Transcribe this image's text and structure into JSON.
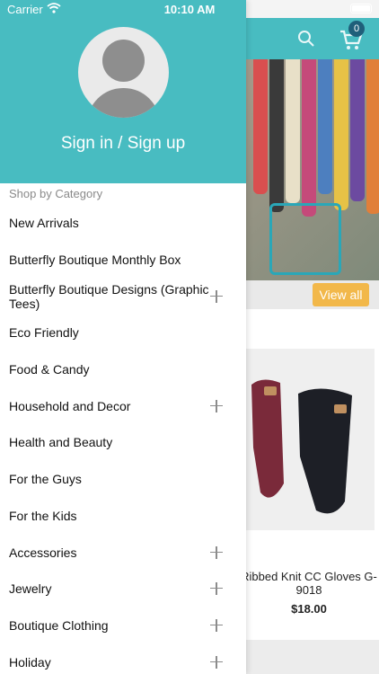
{
  "status_bar": {
    "carrier": "Carrier",
    "time": "10:10 AM"
  },
  "background": {
    "cart_badge": "0",
    "view_all_label": "View all",
    "product": {
      "name": "Ribbed Knit CC Gloves G-9018",
      "price": "$18.00"
    }
  },
  "drawer": {
    "signin_label": "Sign in / Sign up",
    "category_heading": "Shop by Category",
    "items": [
      {
        "label": "New Arrivals",
        "expandable": false
      },
      {
        "label": "Butterfly Boutique Monthly Box",
        "expandable": false
      },
      {
        "label": "Butterfly Boutique Designs (Graphic Tees)",
        "expandable": true
      },
      {
        "label": "Eco Friendly",
        "expandable": false
      },
      {
        "label": "Food & Candy",
        "expandable": false
      },
      {
        "label": "Household and Decor",
        "expandable": true
      },
      {
        "label": "Health and Beauty",
        "expandable": false
      },
      {
        "label": "For the Guys",
        "expandable": false
      },
      {
        "label": "For the Kids",
        "expandable": false
      },
      {
        "label": "Accessories",
        "expandable": true
      },
      {
        "label": "Jewelry",
        "expandable": true
      },
      {
        "label": "Boutique Clothing",
        "expandable": true
      },
      {
        "label": "Holiday",
        "expandable": true
      }
    ]
  },
  "colors": {
    "header_teal": "#48bcc1",
    "view_all_orange": "#f2b84a"
  }
}
